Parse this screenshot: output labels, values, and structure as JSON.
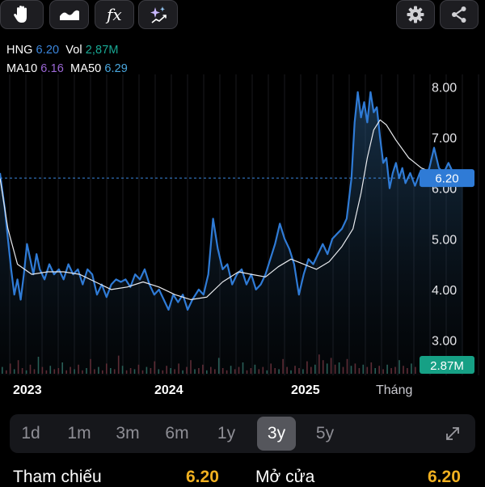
{
  "toolbar": {
    "left_buttons": [
      "hand-icon",
      "area-chart-icon",
      "fx-icon",
      "sparkle-icon"
    ],
    "fx_label": "fx",
    "right_buttons": [
      "gear-icon",
      "share-icon"
    ]
  },
  "legend": {
    "symbol": "HNG",
    "price": "6.20",
    "vol_label": "Vol",
    "vol_value": "2,87M",
    "ma10_label": "MA10",
    "ma10_value": "6.16",
    "ma50_label": "MA50",
    "ma50_value": "6.29"
  },
  "colors": {
    "price_line": "#2f7bd6",
    "ma_line": "#e8eaee",
    "price_tag": "#2f7bd6",
    "vol_tag": "#16a085",
    "vol_text": "#19a894",
    "ma10": "#9b67d6",
    "ma50": "#4aa8e0",
    "stat_value": "#f0b020"
  },
  "chart_data": {
    "type": "area",
    "y_ticks": [
      "8.00",
      "7.00",
      "6.00",
      "5.00",
      "4.00",
      "3.00"
    ],
    "y_tick_values": [
      8,
      7,
      6,
      5,
      4,
      3
    ],
    "ylim": [
      2.6,
      8.5
    ],
    "x_range": [
      2022.75,
      2025.8
    ],
    "x_ticks": [
      {
        "label": "2023",
        "x": 2023.0
      },
      {
        "label": "2024",
        "x": 2024.0
      },
      {
        "label": "2025",
        "x": 2025.0
      }
    ],
    "x_unit_label": "Tháng",
    "current_price": 6.2,
    "current_price_label": "6.20",
    "volume_label": "2.87M",
    "price": [
      [
        2022.75,
        6.3
      ],
      [
        2022.78,
        5.6
      ],
      [
        2022.8,
        5.0
      ],
      [
        2022.82,
        4.4
      ],
      [
        2022.84,
        3.9
      ],
      [
        2022.86,
        4.2
      ],
      [
        2022.88,
        3.8
      ],
      [
        2022.9,
        4.3
      ],
      [
        2022.92,
        4.9
      ],
      [
        2022.94,
        4.6
      ],
      [
        2022.96,
        4.3
      ],
      [
        2022.98,
        4.7
      ],
      [
        2023.0,
        4.4
      ],
      [
        2023.03,
        4.2
      ],
      [
        2023.06,
        4.5
      ],
      [
        2023.09,
        4.3
      ],
      [
        2023.12,
        4.4
      ],
      [
        2023.15,
        4.2
      ],
      [
        2023.18,
        4.5
      ],
      [
        2023.21,
        4.3
      ],
      [
        2023.24,
        4.4
      ],
      [
        2023.27,
        4.1
      ],
      [
        2023.3,
        4.4
      ],
      [
        2023.33,
        4.3
      ],
      [
        2023.36,
        3.9
      ],
      [
        2023.39,
        4.1
      ],
      [
        2023.42,
        3.85
      ],
      [
        2023.45,
        4.1
      ],
      [
        2023.48,
        4.2
      ],
      [
        2023.51,
        4.15
      ],
      [
        2023.54,
        4.2
      ],
      [
        2023.57,
        4.05
      ],
      [
        2023.6,
        4.3
      ],
      [
        2023.63,
        4.2
      ],
      [
        2023.66,
        4.4
      ],
      [
        2023.69,
        4.1
      ],
      [
        2023.72,
        3.9
      ],
      [
        2023.75,
        4.0
      ],
      [
        2023.78,
        3.8
      ],
      [
        2023.81,
        3.6
      ],
      [
        2023.84,
        3.9
      ],
      [
        2023.87,
        3.75
      ],
      [
        2023.9,
        3.9
      ],
      [
        2023.93,
        3.6
      ],
      [
        2023.96,
        3.8
      ],
      [
        2024.0,
        4.0
      ],
      [
        2024.03,
        3.9
      ],
      [
        2024.06,
        4.3
      ],
      [
        2024.09,
        5.4
      ],
      [
        2024.12,
        4.8
      ],
      [
        2024.15,
        4.4
      ],
      [
        2024.18,
        4.5
      ],
      [
        2024.21,
        4.1
      ],
      [
        2024.24,
        4.3
      ],
      [
        2024.27,
        4.4
      ],
      [
        2024.3,
        4.1
      ],
      [
        2024.33,
        4.3
      ],
      [
        2024.36,
        4.0
      ],
      [
        2024.39,
        4.1
      ],
      [
        2024.42,
        4.3
      ],
      [
        2024.45,
        4.6
      ],
      [
        2024.48,
        4.9
      ],
      [
        2024.51,
        5.3
      ],
      [
        2024.54,
        5.0
      ],
      [
        2024.57,
        4.8
      ],
      [
        2024.6,
        4.5
      ],
      [
        2024.63,
        3.9
      ],
      [
        2024.66,
        4.3
      ],
      [
        2024.69,
        4.6
      ],
      [
        2024.72,
        4.5
      ],
      [
        2024.75,
        4.7
      ],
      [
        2024.78,
        4.9
      ],
      [
        2024.81,
        4.7
      ],
      [
        2024.84,
        5.0
      ],
      [
        2024.87,
        5.1
      ],
      [
        2024.9,
        5.2
      ],
      [
        2024.93,
        5.4
      ],
      [
        2024.96,
        6.2
      ],
      [
        2024.98,
        7.3
      ],
      [
        2025.0,
        7.9
      ],
      [
        2025.02,
        7.4
      ],
      [
        2025.04,
        7.7
      ],
      [
        2025.06,
        7.3
      ],
      [
        2025.08,
        7.9
      ],
      [
        2025.1,
        7.5
      ],
      [
        2025.12,
        7.6
      ],
      [
        2025.14,
        7.0
      ],
      [
        2025.16,
        6.5
      ],
      [
        2025.18,
        6.6
      ],
      [
        2025.2,
        6.0
      ],
      [
        2025.22,
        6.3
      ],
      [
        2025.24,
        6.5
      ],
      [
        2025.26,
        6.2
      ],
      [
        2025.28,
        6.4
      ],
      [
        2025.3,
        6.1
      ],
      [
        2025.33,
        6.3
      ],
      [
        2025.36,
        6.05
      ],
      [
        2025.39,
        6.3
      ],
      [
        2025.42,
        6.2
      ],
      [
        2025.45,
        6.4
      ],
      [
        2025.48,
        6.8
      ],
      [
        2025.51,
        6.4
      ],
      [
        2025.54,
        6.3
      ],
      [
        2025.57,
        6.5
      ],
      [
        2025.6,
        6.3
      ],
      [
        2025.63,
        6.15
      ],
      [
        2025.65,
        6.3
      ],
      [
        2025.66,
        6.2
      ]
    ],
    "ma50": [
      [
        2022.75,
        6.2
      ],
      [
        2022.8,
        5.2
      ],
      [
        2022.86,
        4.5
      ],
      [
        2022.95,
        4.3
      ],
      [
        2023.05,
        4.35
      ],
      [
        2023.15,
        4.35
      ],
      [
        2023.25,
        4.3
      ],
      [
        2023.35,
        4.15
      ],
      [
        2023.45,
        4.0
      ],
      [
        2023.55,
        4.05
      ],
      [
        2023.65,
        4.15
      ],
      [
        2023.75,
        4.05
      ],
      [
        2023.85,
        3.9
      ],
      [
        2023.95,
        3.8
      ],
      [
        2024.05,
        3.85
      ],
      [
        2024.15,
        4.15
      ],
      [
        2024.25,
        4.35
      ],
      [
        2024.33,
        4.3
      ],
      [
        2024.42,
        4.25
      ],
      [
        2024.5,
        4.45
      ],
      [
        2024.58,
        4.6
      ],
      [
        2024.66,
        4.5
      ],
      [
        2024.74,
        4.4
      ],
      [
        2024.82,
        4.55
      ],
      [
        2024.9,
        4.85
      ],
      [
        2024.97,
        5.2
      ],
      [
        2025.02,
        5.9
      ],
      [
        2025.06,
        6.6
      ],
      [
        2025.1,
        7.15
      ],
      [
        2025.14,
        7.35
      ],
      [
        2025.18,
        7.25
      ],
      [
        2025.24,
        6.95
      ],
      [
        2025.32,
        6.6
      ],
      [
        2025.4,
        6.4
      ],
      [
        2025.48,
        6.3
      ],
      [
        2025.56,
        6.3
      ],
      [
        2025.63,
        6.3
      ],
      [
        2025.66,
        6.29
      ]
    ],
    "volume": [
      0.6,
      0.3,
      0.9,
      0.4,
      1.2,
      0.5,
      0.3,
      0.8,
      0.4,
      1.5,
      0.6,
      0.3,
      0.7,
      0.4,
      0.5,
      1.0,
      0.3,
      0.6,
      0.4,
      0.8,
      0.3,
      0.5,
      1.3,
      0.4,
      0.6,
      0.3,
      0.9,
      0.5,
      0.4,
      1.6,
      0.7,
      0.3,
      0.5,
      0.4,
      0.8,
      0.3,
      0.6,
      0.5,
      1.1,
      0.4,
      0.3,
      0.7,
      0.5,
      0.4,
      0.9,
      0.3,
      0.6,
      1.2,
      0.4,
      0.5,
      0.8,
      0.3,
      0.6,
      0.4,
      1.4,
      0.5,
      0.3,
      0.7,
      0.4,
      0.6,
      1.0,
      0.3,
      0.5,
      0.8,
      0.4,
      0.6,
      0.3,
      0.9,
      0.5,
      0.4,
      1.3,
      0.6,
      0.3,
      0.7,
      0.5,
      0.4,
      1.1,
      0.6,
      0.8,
      1.7,
      1.2,
      0.9,
      1.4,
      0.8,
      1.0,
      0.6,
      1.3,
      0.7,
      0.9,
      0.5,
      0.8,
      0.6,
      1.0,
      0.5,
      0.7,
      0.4,
      0.8,
      0.5,
      0.6,
      1.2,
      0.7,
      0.5,
      0.9,
      0.6
    ]
  },
  "x_axis_labels": {
    "y2023": "2023",
    "y2024": "2024",
    "y2025": "2025",
    "month": "Tháng"
  },
  "ranges": {
    "items": [
      "1d",
      "1m",
      "3m",
      "6m",
      "1y",
      "3y",
      "5y"
    ],
    "selected": "3y"
  },
  "stats": {
    "ref_label": "Tham chiếu",
    "ref_value": "6.20",
    "open_label": "Mở cửa",
    "open_value": "6.20"
  }
}
